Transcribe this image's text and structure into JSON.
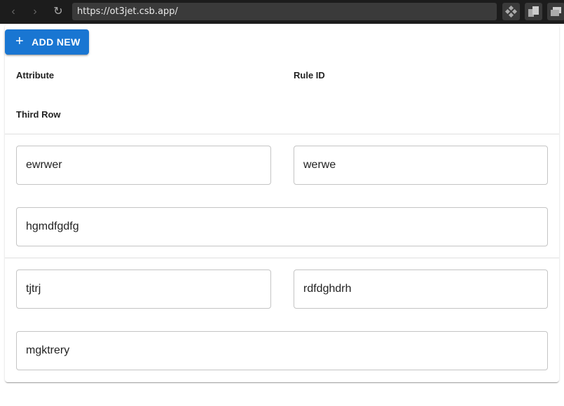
{
  "browser": {
    "url": "https://ot3jet.csb.app/",
    "back_icon": "‹",
    "forward_icon": "›",
    "reload_icon": "↻"
  },
  "toolbar": {
    "add_new_label": "ADD NEW",
    "add_icon": "+"
  },
  "table_header": {
    "columns": [
      "Attribute",
      "Rule ID",
      "Third Row"
    ]
  },
  "rows": [
    {
      "attribute": "ewrwer",
      "rule_id": "werwe",
      "third_row": "hgmdfgdfg"
    },
    {
      "attribute": "tjtrj",
      "rule_id": "rdfdghdrh",
      "third_row": "mgktrery"
    }
  ],
  "colors": {
    "primary": "#1976d2",
    "browser_bar": "#1c1c1c",
    "url_box": "#3a3a3a",
    "field_border": "#c4c4c4",
    "divider": "#e0e0e0"
  }
}
